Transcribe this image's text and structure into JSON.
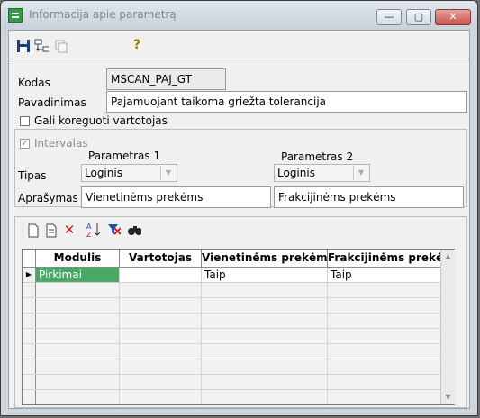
{
  "window": {
    "title": "Informacija apie parametrą",
    "buttons": {
      "minimize": "—",
      "maximize": "▢",
      "close": "✕"
    }
  },
  "toolbar": {
    "icons": [
      "save-icon",
      "tree-icon",
      "copy-icon",
      "help-icon"
    ],
    "help_glyph": "?"
  },
  "form": {
    "code_label": "Kodas",
    "code_value": "MSCAN_PAJ_GT",
    "name_label": "Pavadinimas",
    "name_value": "Pajamuojant taikoma griežta tolerancija",
    "user_editable_label": "Gali koreguoti vartotojas",
    "user_editable_checked": false,
    "interval_label": "Intervalas",
    "interval_checked": true
  },
  "params": {
    "param1_header": "Parametras 1",
    "param2_header": "Parametras 2",
    "type_label": "Tipas",
    "type1_value": "Loginis",
    "type2_value": "Loginis",
    "desc_label": "Aprašymas",
    "desc1_value": "Vienetinėms prekėms",
    "desc2_value": "Frakcijinėms prekėms"
  },
  "grid_toolbar": {
    "icons": [
      "new-icon",
      "edit-icon",
      "delete-icon",
      "sort-icon",
      "clear-filter-icon",
      "find-icon"
    ]
  },
  "grid": {
    "columns": [
      "Modulis",
      "Vartotojas",
      "Vienetinėms prekėms",
      "Frakcijinėms prekėms"
    ],
    "rows": [
      [
        "Pirkimai",
        "",
        "Taip",
        "Taip"
      ]
    ]
  },
  "colors": {
    "selected_cell": "#48a865",
    "title_text": "#7d8793",
    "close_button": "#c4544a"
  }
}
